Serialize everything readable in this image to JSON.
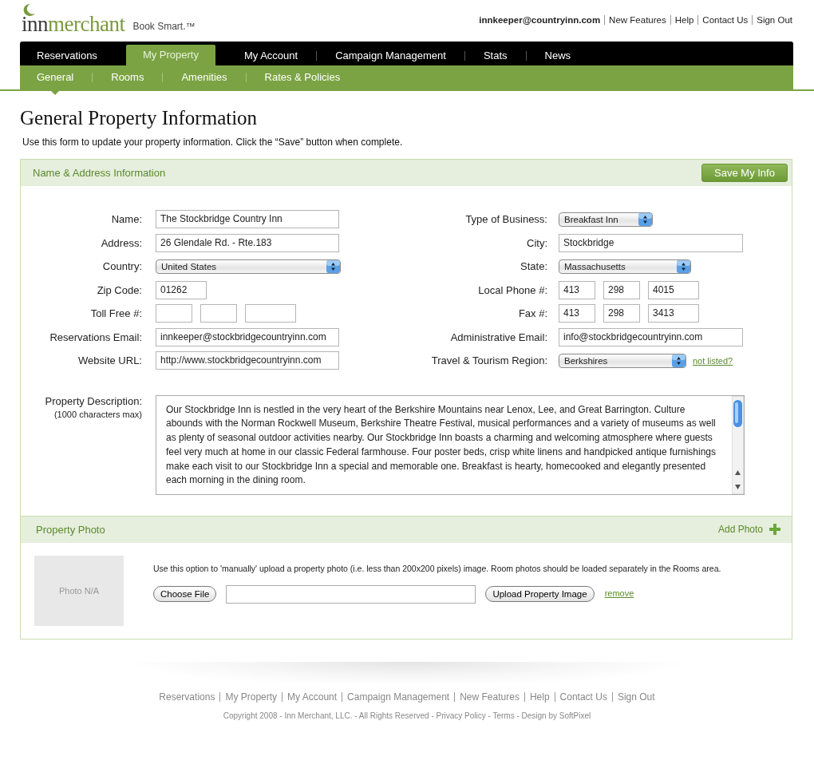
{
  "header": {
    "logo": "innmerchant",
    "tagline": "Book Smart.™",
    "user": "innkeeper@countryinn.com",
    "links": [
      "New Features",
      "Help",
      "Contact Us",
      "Sign Out"
    ]
  },
  "main_nav": [
    {
      "label": "Reservations",
      "selected": false
    },
    {
      "label": "My Property",
      "selected": true
    },
    {
      "label": "My Account",
      "selected": false
    },
    {
      "label": "Campaign Management",
      "selected": false
    },
    {
      "label": "Stats",
      "selected": false
    },
    {
      "label": "News",
      "selected": false
    }
  ],
  "sub_nav": [
    {
      "label": "General",
      "selected": true
    },
    {
      "label": "Rooms",
      "selected": false
    },
    {
      "label": "Amenities",
      "selected": false
    },
    {
      "label": "Rates & Policies",
      "selected": false
    }
  ],
  "page": {
    "title": "General Property Information",
    "intro": "Use this form to update your property information. Click the “Save” button when complete."
  },
  "address_section": {
    "title": "Name & Address Information",
    "save_button": "Save My Info",
    "left_fields": [
      {
        "label": "Name:",
        "kind": "text",
        "values": [
          "The Stockbridge Country Inn"
        ]
      },
      {
        "label": "Address:",
        "kind": "text",
        "values": [
          "26 Glendale Rd. - Rte.183"
        ]
      },
      {
        "label": "Country:",
        "kind": "select",
        "value": "United States"
      },
      {
        "label": "Zip Code:",
        "kind": "short",
        "values": [
          "01262"
        ]
      },
      {
        "label": "Toll Free #:",
        "kind": "phone"
      },
      {
        "label": "Reservations Email:",
        "kind": "text",
        "values": [
          "innkeeper@stockbridgecountryinn.com"
        ]
      },
      {
        "label": "Website URL:",
        "kind": "text",
        "values": [
          "http://www.stockbridgecountryinn.com"
        ]
      }
    ],
    "right_fields": [
      {
        "label": "Type of Business:",
        "kind": "select",
        "value": "Breakfast Inn"
      },
      {
        "label": "City:",
        "kind": "text",
        "values": [
          "Stockbridge"
        ]
      },
      {
        "label": "State:",
        "kind": "select",
        "value": "Massachusetts"
      },
      {
        "label": "Local Phone #:",
        "kind": "phone",
        "values": [
          "413",
          "298",
          "4015"
        ]
      },
      {
        "label": "Fax #:",
        "kind": "phone",
        "values": [
          "413",
          "298",
          "3413"
        ]
      },
      {
        "label": "Administrative Email:",
        "kind": "text",
        "values": [
          "info@stockbridgecountryinn.com"
        ]
      },
      {
        "label": "Travel & Tourism Region:",
        "kind": "select",
        "value": "Berkshires",
        "link": "not listed?"
      }
    ],
    "description": {
      "label": "Property Description:",
      "note": "(1000 characters max)",
      "text": "Our Stockbridge Inn is nestled in the very heart of the Berkshire Mountains near Lenox, Lee, and Great Barrington. Culture abounds with the Norman Rockwell Museum, Berkshire Theatre Festival, musical performances and a variety of museums as well as plenty of seasonal outdoor activities nearby. Our Stockbridge Inn boasts a charming and welcoming atmosphere where guests feel very much at home in our classic Federal farmhouse. Four poster beds, crisp white linens and handpicked antique furnishings make each visit to our Stockbridge Inn a special and memorable one. Breakfast is hearty, homecooked and elegantly presented each morning in the dining room."
    }
  },
  "photo_section": {
    "title": "Property Photo",
    "add_link": "Add Photo",
    "photo_placeholder": "Photo N/A",
    "instructions": "Use this option to 'manually' upload a property photo (i.e. less than 200x200 pixels) image. Room photos should be loaded separately in the Rooms area.",
    "choose_button": "Choose File",
    "upload_button": "Upload Property Image",
    "remove_link": "remove"
  },
  "footer": {
    "links": [
      "Reservations",
      "My Property",
      "My Account",
      "Campaign Management",
      "New Features",
      "Help",
      "Contact Us",
      "Sign Out"
    ],
    "copyright": "Copyright 2008 - Inn Merchant, LLC. - All Rights Reserved - Privacy Policy - Terms - Design by SoftPixel"
  }
}
